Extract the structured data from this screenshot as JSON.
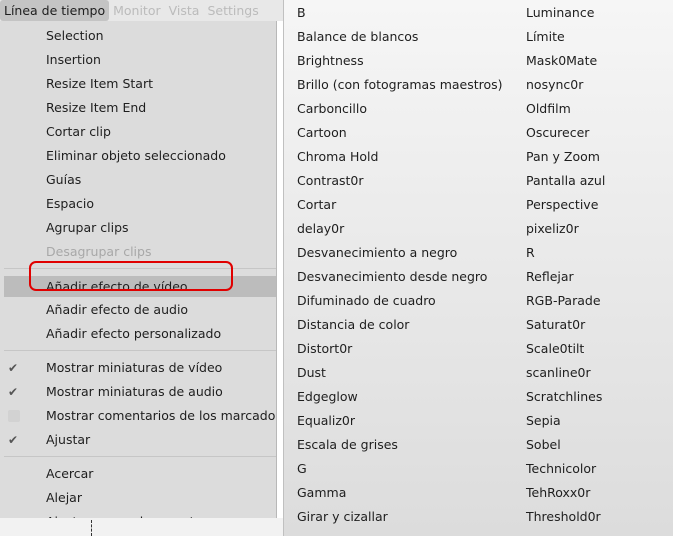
{
  "menubar": [
    "Línea de tiempo",
    "Monitor",
    "Vista",
    "Settings"
  ],
  "timeline_menu": [
    {
      "label": "Selection"
    },
    {
      "label": "Insertion"
    },
    {
      "label": "Resize Item Start"
    },
    {
      "label": "Resize Item End"
    },
    {
      "label": "Cortar clip"
    },
    {
      "label": "Eliminar objeto seleccionado"
    },
    {
      "label": "Guías"
    },
    {
      "label": "Espacio"
    },
    {
      "label": "Agrupar clips"
    },
    {
      "label": "Desagrupar clips",
      "disabled": true
    },
    {
      "sep": true
    },
    {
      "label": "Añadir efecto de vídeo",
      "highlighted": true
    },
    {
      "label": "Añadir efecto de audio"
    },
    {
      "label": "Añadir efecto personalizado"
    },
    {
      "sep": true
    },
    {
      "label": "Mostrar miniaturas de vídeo",
      "checked": true
    },
    {
      "label": "Mostrar miniaturas de audio",
      "checked": true
    },
    {
      "label": "Mostrar comentarios de los marcadores",
      "checked": false
    },
    {
      "label": "Ajustar",
      "checked": true
    },
    {
      "sep": true
    },
    {
      "label": "Acercar"
    },
    {
      "label": "Alejar"
    },
    {
      "label": "Ajustar zoom al proyecto"
    }
  ],
  "effects_col1": [
    "B",
    "Balance de blancos",
    "Brightness",
    "Brillo (con fotogramas maestros)",
    "Carboncillo",
    "Cartoon",
    "Chroma Hold",
    "Contrast0r",
    "Cortar",
    "delay0r",
    "Desvanecimiento a negro",
    "Desvanecimiento desde negro",
    "Difuminado de cuadro",
    "Distancia de color",
    "Distort0r",
    "Dust",
    "Edgeglow",
    "Equaliz0r",
    "Escala de grises",
    "G",
    "Gamma",
    "Girar y cizallar"
  ],
  "effects_col2": [
    "Luminance",
    "Límite",
    "Mask0Mate",
    "nosync0r",
    "Oldfilm",
    "Oscurecer",
    "Pan y Zoom",
    "Pantalla azul",
    "Perspective",
    "pixeliz0r",
    "R",
    "Reflejar",
    "RGB-Parade",
    "Saturat0r",
    "Scale0tilt",
    "scanline0r",
    "Scratchlines",
    "Sepia",
    "Sobel",
    "Technicolor",
    "TehRoxx0r",
    "Threshold0r"
  ],
  "colors": {
    "highlight_box": "#e00000"
  }
}
